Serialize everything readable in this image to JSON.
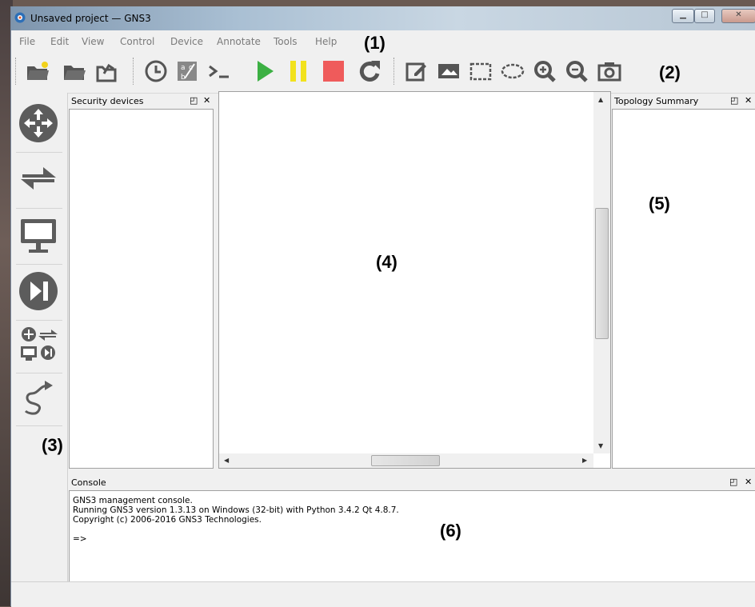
{
  "window": {
    "title": "Unsaved project — GNS3"
  },
  "menu": [
    "File",
    "Edit",
    "View",
    "Control",
    "Device",
    "Annotate",
    "Tools",
    "Help"
  ],
  "toolbar": {
    "icons": [
      "new-project-icon",
      "open-project-icon",
      "save-project-icon",
      "snapshot-clock-icon",
      "show-interface-labels-icon",
      "console-all-icon",
      "start-all-icon",
      "suspend-all-icon",
      "stop-all-icon",
      "reload-all-icon",
      "add-note-icon",
      "insert-picture-icon",
      "draw-rectangle-icon",
      "draw-ellipse-icon",
      "zoom-in-icon",
      "zoom-out-icon",
      "screenshot-icon"
    ]
  },
  "device_bar": {
    "icons": [
      "routers-icon",
      "switches-icon",
      "end-devices-icon",
      "security-devices-icon",
      "all-devices-icon",
      "add-link-icon"
    ]
  },
  "docks": {
    "left_title": "Security devices",
    "right_title": "Topology Summary",
    "console_title": "Console",
    "float_glyph": "◰",
    "close_glyph": "✕"
  },
  "console": {
    "lines": [
      "GNS3 management console.",
      "Running GNS3 version 1.3.13 on Windows (32-bit) with Python 3.4.2 Qt 4.8.7.",
      "Copyright (c) 2006-2016 GNS3 Technologies.",
      "",
      "=>"
    ]
  },
  "annotations": {
    "a1": "(1)",
    "a2": "(2)",
    "a3": "(3)",
    "a4": "(4)",
    "a5": "(5)",
    "a6": "(6)"
  },
  "colors": {
    "play": "#3cb043",
    "pause": "#f2e21c",
    "stop": "#ef5b5b",
    "device_icon": "#5c5c5c"
  }
}
